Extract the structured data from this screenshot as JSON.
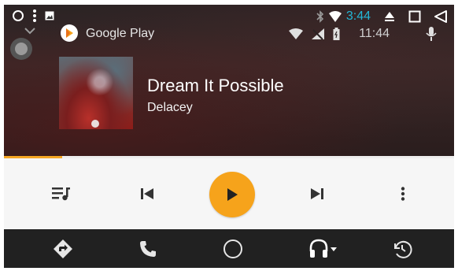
{
  "system_bar": {
    "clock": "3:44",
    "icons": [
      "circle-icon",
      "more-vert-icon",
      "image-notification-icon",
      "bluetooth-icon",
      "wifi-icon",
      "eject-icon",
      "square-icon",
      "triangle-back-icon"
    ]
  },
  "app_header": {
    "app_name": "Google Play",
    "clock": "11:44",
    "icons": [
      "chevron-down-icon",
      "google-play-logo",
      "wifi-icon",
      "no-signal-icon",
      "battery-icon",
      "mic-icon"
    ]
  },
  "now_playing": {
    "title": "Dream It Possible",
    "artist": "Delacey",
    "progress": 0.13
  },
  "controls": {
    "icons": [
      "queue-music-icon",
      "skip-previous-icon",
      "play-icon",
      "skip-next-icon",
      "more-vert-icon"
    ]
  },
  "nav": {
    "icons": [
      "navigation-icon",
      "phone-icon",
      "home-circle-icon",
      "headphones-icon",
      "recent-icon"
    ]
  },
  "colors": {
    "accent": "#f6a31b",
    "clock": "#23b6d6",
    "navbar": "#212121",
    "controls_bg": "#f6f6f6"
  }
}
